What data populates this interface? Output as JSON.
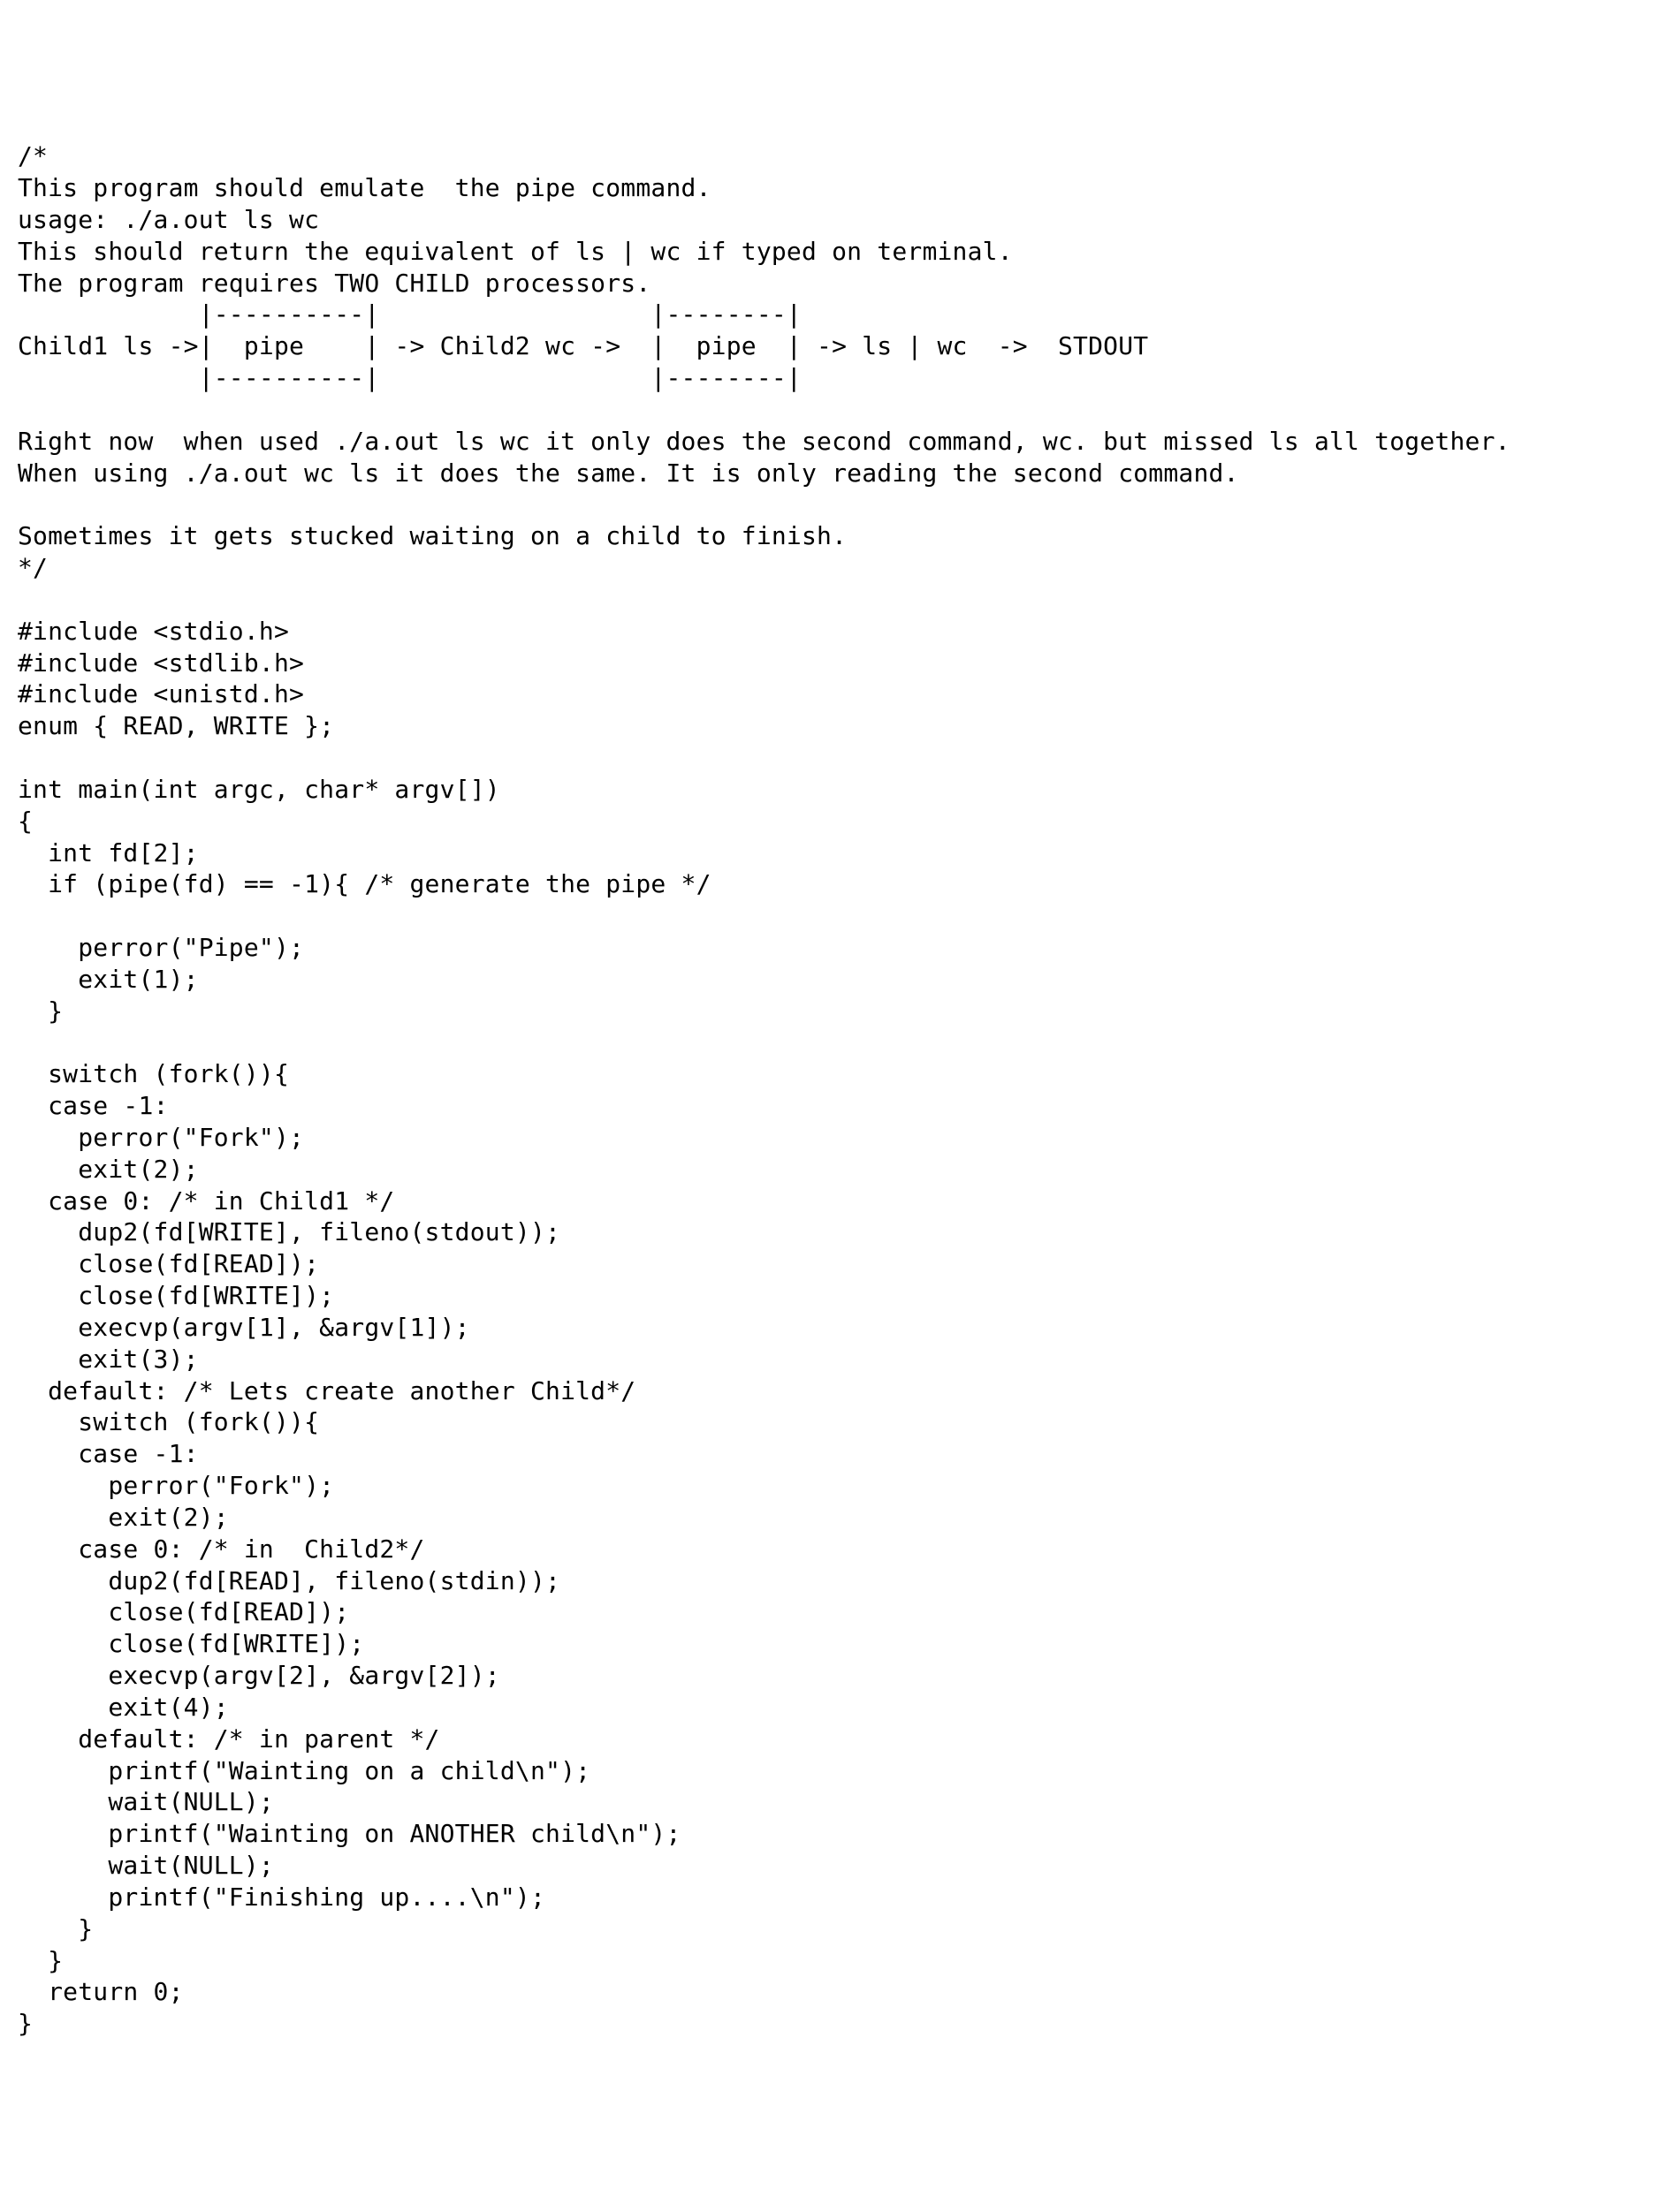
{
  "code": "/*\nThis program should emulate  the pipe command.\nusage: ./a.out ls wc\nThis should return the equivalent of ls | wc if typed on terminal.\nThe program requires TWO CHILD processors.\n            |----------|                  |--------|\nChild1 ls ->|  pipe    | -> Child2 wc ->  |  pipe  | -> ls | wc  ->  STDOUT\n            |----------|                  |--------|\n\nRight now  when used ./a.out ls wc it only does the second command, wc. but missed ls all together.\nWhen using ./a.out wc ls it does the same. It is only reading the second command.\n\nSometimes it gets stucked waiting on a child to finish.\n*/\n\n#include <stdio.h>\n#include <stdlib.h>\n#include <unistd.h>\nenum { READ, WRITE };\n\nint main(int argc, char* argv[])\n{\n  int fd[2];\n  if (pipe(fd) == -1){ /* generate the pipe */\n\n    perror(\"Pipe\");\n    exit(1);\n  }\n\n  switch (fork()){\n  case -1:\n    perror(\"Fork\");\n    exit(2);\n  case 0: /* in Child1 */\n    dup2(fd[WRITE], fileno(stdout));\n    close(fd[READ]);\n    close(fd[WRITE]);\n    execvp(argv[1], &argv[1]);\n    exit(3);\n  default: /* Lets create another Child*/\n    switch (fork()){\n    case -1:\n      perror(\"Fork\");\n      exit(2);\n    case 0: /* in  Child2*/\n      dup2(fd[READ], fileno(stdin));\n      close(fd[READ]);\n      close(fd[WRITE]);\n      execvp(argv[2], &argv[2]);\n      exit(4);\n    default: /* in parent */\n      printf(\"Wainting on a child\\n\");\n      wait(NULL);\n      printf(\"Wainting on ANOTHER child\\n\");\n      wait(NULL);\n      printf(\"Finishing up....\\n\");\n    }\n  }\n  return 0;\n}"
}
